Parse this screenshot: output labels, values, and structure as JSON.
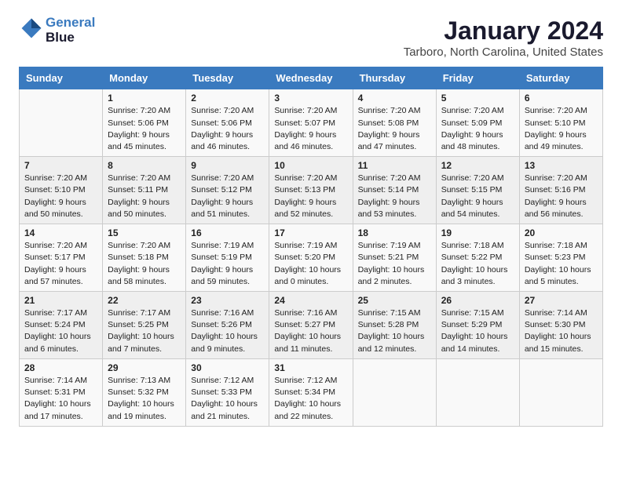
{
  "logo": {
    "line1": "General",
    "line2": "Blue"
  },
  "title": "January 2024",
  "subtitle": "Tarboro, North Carolina, United States",
  "weekdays": [
    "Sunday",
    "Monday",
    "Tuesday",
    "Wednesday",
    "Thursday",
    "Friday",
    "Saturday"
  ],
  "weeks": [
    [
      {
        "day": "",
        "info": ""
      },
      {
        "day": "1",
        "info": "Sunrise: 7:20 AM\nSunset: 5:06 PM\nDaylight: 9 hours\nand 45 minutes."
      },
      {
        "day": "2",
        "info": "Sunrise: 7:20 AM\nSunset: 5:06 PM\nDaylight: 9 hours\nand 46 minutes."
      },
      {
        "day": "3",
        "info": "Sunrise: 7:20 AM\nSunset: 5:07 PM\nDaylight: 9 hours\nand 46 minutes."
      },
      {
        "day": "4",
        "info": "Sunrise: 7:20 AM\nSunset: 5:08 PM\nDaylight: 9 hours\nand 47 minutes."
      },
      {
        "day": "5",
        "info": "Sunrise: 7:20 AM\nSunset: 5:09 PM\nDaylight: 9 hours\nand 48 minutes."
      },
      {
        "day": "6",
        "info": "Sunrise: 7:20 AM\nSunset: 5:10 PM\nDaylight: 9 hours\nand 49 minutes."
      }
    ],
    [
      {
        "day": "7",
        "info": "Sunrise: 7:20 AM\nSunset: 5:10 PM\nDaylight: 9 hours\nand 50 minutes."
      },
      {
        "day": "8",
        "info": "Sunrise: 7:20 AM\nSunset: 5:11 PM\nDaylight: 9 hours\nand 50 minutes."
      },
      {
        "day": "9",
        "info": "Sunrise: 7:20 AM\nSunset: 5:12 PM\nDaylight: 9 hours\nand 51 minutes."
      },
      {
        "day": "10",
        "info": "Sunrise: 7:20 AM\nSunset: 5:13 PM\nDaylight: 9 hours\nand 52 minutes."
      },
      {
        "day": "11",
        "info": "Sunrise: 7:20 AM\nSunset: 5:14 PM\nDaylight: 9 hours\nand 53 minutes."
      },
      {
        "day": "12",
        "info": "Sunrise: 7:20 AM\nSunset: 5:15 PM\nDaylight: 9 hours\nand 54 minutes."
      },
      {
        "day": "13",
        "info": "Sunrise: 7:20 AM\nSunset: 5:16 PM\nDaylight: 9 hours\nand 56 minutes."
      }
    ],
    [
      {
        "day": "14",
        "info": "Sunrise: 7:20 AM\nSunset: 5:17 PM\nDaylight: 9 hours\nand 57 minutes."
      },
      {
        "day": "15",
        "info": "Sunrise: 7:20 AM\nSunset: 5:18 PM\nDaylight: 9 hours\nand 58 minutes."
      },
      {
        "day": "16",
        "info": "Sunrise: 7:19 AM\nSunset: 5:19 PM\nDaylight: 9 hours\nand 59 minutes."
      },
      {
        "day": "17",
        "info": "Sunrise: 7:19 AM\nSunset: 5:20 PM\nDaylight: 10 hours\nand 0 minutes."
      },
      {
        "day": "18",
        "info": "Sunrise: 7:19 AM\nSunset: 5:21 PM\nDaylight: 10 hours\nand 2 minutes."
      },
      {
        "day": "19",
        "info": "Sunrise: 7:18 AM\nSunset: 5:22 PM\nDaylight: 10 hours\nand 3 minutes."
      },
      {
        "day": "20",
        "info": "Sunrise: 7:18 AM\nSunset: 5:23 PM\nDaylight: 10 hours\nand 5 minutes."
      }
    ],
    [
      {
        "day": "21",
        "info": "Sunrise: 7:17 AM\nSunset: 5:24 PM\nDaylight: 10 hours\nand 6 minutes."
      },
      {
        "day": "22",
        "info": "Sunrise: 7:17 AM\nSunset: 5:25 PM\nDaylight: 10 hours\nand 7 minutes."
      },
      {
        "day": "23",
        "info": "Sunrise: 7:16 AM\nSunset: 5:26 PM\nDaylight: 10 hours\nand 9 minutes."
      },
      {
        "day": "24",
        "info": "Sunrise: 7:16 AM\nSunset: 5:27 PM\nDaylight: 10 hours\nand 11 minutes."
      },
      {
        "day": "25",
        "info": "Sunrise: 7:15 AM\nSunset: 5:28 PM\nDaylight: 10 hours\nand 12 minutes."
      },
      {
        "day": "26",
        "info": "Sunrise: 7:15 AM\nSunset: 5:29 PM\nDaylight: 10 hours\nand 14 minutes."
      },
      {
        "day": "27",
        "info": "Sunrise: 7:14 AM\nSunset: 5:30 PM\nDaylight: 10 hours\nand 15 minutes."
      }
    ],
    [
      {
        "day": "28",
        "info": "Sunrise: 7:14 AM\nSunset: 5:31 PM\nDaylight: 10 hours\nand 17 minutes."
      },
      {
        "day": "29",
        "info": "Sunrise: 7:13 AM\nSunset: 5:32 PM\nDaylight: 10 hours\nand 19 minutes."
      },
      {
        "day": "30",
        "info": "Sunrise: 7:12 AM\nSunset: 5:33 PM\nDaylight: 10 hours\nand 21 minutes."
      },
      {
        "day": "31",
        "info": "Sunrise: 7:12 AM\nSunset: 5:34 PM\nDaylight: 10 hours\nand 22 minutes."
      },
      {
        "day": "",
        "info": ""
      },
      {
        "day": "",
        "info": ""
      },
      {
        "day": "",
        "info": ""
      }
    ]
  ]
}
